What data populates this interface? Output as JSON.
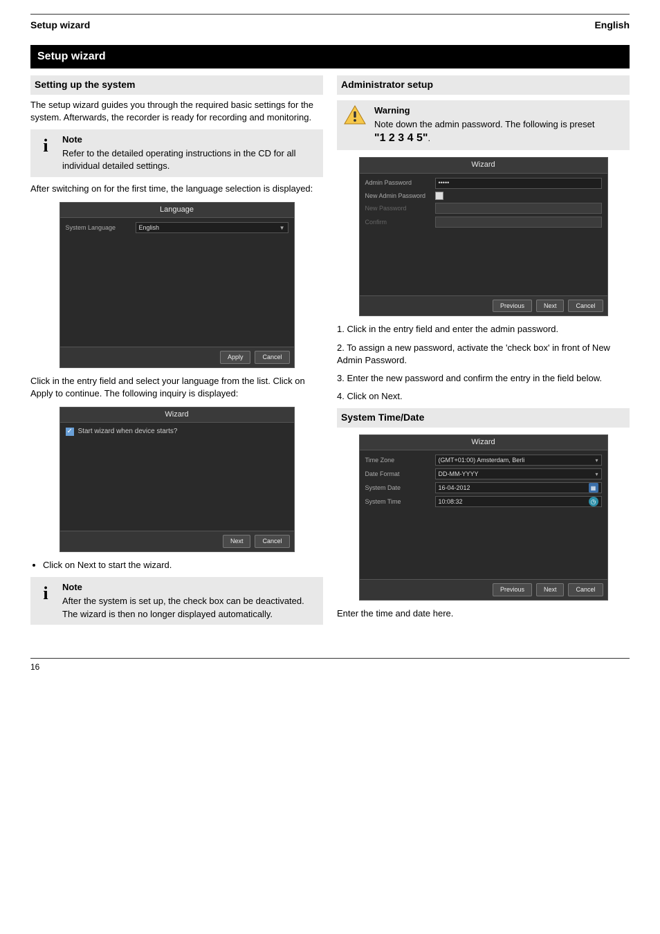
{
  "header": {
    "left": "Setup wizard",
    "right": "English"
  },
  "section_title": "Setup wizard",
  "left": {
    "sub1": "Setting up the system",
    "para1": "The setup wizard guides you through the required basic settings for the system. Afterwards, the recorder is ready for recording and monitoring.",
    "note1_head": "Note",
    "note1_body": "Refer to the detailed operating instructions in the CD for all individual detailed settings.",
    "para2": "After switching on for the first time, the language selection is displayed:",
    "lang_panel": {
      "title": "Language",
      "row_label": "System Language",
      "row_value": "English",
      "apply": "Apply",
      "cancel": "Cancel"
    },
    "bullet1": "Click in the entry field and select your language from the list. Click on Apply to continue. The following inquiry is displayed:",
    "wiz1_panel": {
      "title": "Wizard",
      "checkbox_label": "Start wizard when device starts?",
      "next": "Next",
      "cancel": "Cancel"
    },
    "bullet2": "Click on Next to start the wizard.",
    "note2_head": "Note",
    "note2_body": "After the system is set up, the check box can be deactivated. The wizard is then no longer displayed automatically."
  },
  "right": {
    "sub1": "Administrator setup",
    "warn_head": "Warning",
    "warn_body1": "Note down the admin password. The following is preset",
    "warn_pw": "\"1 2 3 4 5\"",
    "warn_body2": ".",
    "wiz2_panel": {
      "title": "Wizard",
      "r1_label": "Admin Password",
      "r1_value": "•••••",
      "r2_label": "New Admin Password",
      "r3_label": "New Password",
      "r4_label": "Confirm",
      "prev": "Previous",
      "next": "Next",
      "cancel": "Cancel"
    },
    "para_a1": "1. Click in the entry field and enter the admin password.",
    "para_a2": "2. To assign a new password, activate the 'check box' in front of New Admin Password.",
    "para_a3": "3. Enter the new password and confirm the entry in the field below.",
    "para_a4": "4. Click on Next.",
    "sub2": "System Time/Date",
    "wiz3_panel": {
      "title": "Wizard",
      "r1_label": "Time Zone",
      "r1_value": "(GMT+01:00) Amsterdam, Berli",
      "r2_label": "Date Format",
      "r2_value": "DD-MM-YYYY",
      "r3_label": "System Date",
      "r3_value": "16-04-2012",
      "r4_label": "System Time",
      "r4_value": "10:08:32",
      "prev": "Previous",
      "next": "Next",
      "cancel": "Cancel"
    },
    "para_b": "Enter the time and date here."
  },
  "footer": {
    "left": "16",
    "right": ""
  }
}
